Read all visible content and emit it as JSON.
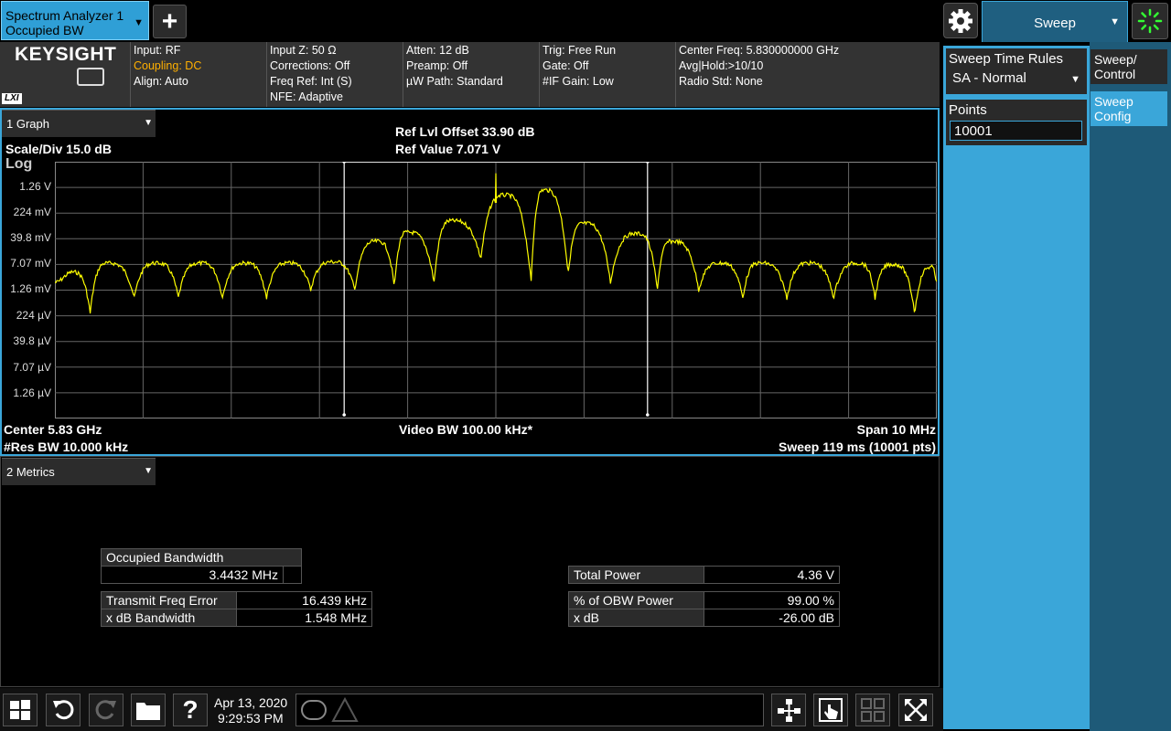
{
  "window": {
    "tab_line1": "Spectrum Analyzer 1",
    "tab_line2": "Occupied BW",
    "mode_tab_label": "Sweep"
  },
  "brand": {
    "name": "KEYSIGHT",
    "lxi": "LXI"
  },
  "info": {
    "col1": [
      "Input: RF",
      "Coupling: DC",
      "Align: Auto"
    ],
    "col2": [
      "Input Z: 50 Ω",
      "Corrections: Off",
      "Freq Ref: Int (S)",
      "NFE: Adaptive"
    ],
    "col3": [
      "Atten: 12 dB",
      "Preamp: Off",
      "µW Path: Standard"
    ],
    "col4": [
      "Trig: Free Run",
      "Gate: Off",
      "#IF Gain: Low"
    ],
    "col5": [
      "Center Freq: 5.830000000 GHz",
      "Avg|Hold:>10/10",
      "Radio Std: None"
    ]
  },
  "graph": {
    "window_label": "1 Graph",
    "scale_div": "Scale/Div 15.0 dB",
    "log_label": "Log",
    "ref_offset": "Ref Lvl Offset 33.90 dB",
    "ref_value": "Ref Value 7.071 V",
    "center": "Center 5.83 GHz",
    "res_bw": "#Res BW 10.000 kHz",
    "video_bw": "Video BW 100.00 kHz*",
    "span": "Span 10 MHz",
    "sweep": "Sweep 119 ms (10001 pts)"
  },
  "chart_data": {
    "type": "line",
    "title": "",
    "xlabel": "",
    "ylabel": "",
    "x_range_mhz": [
      5825,
      5835
    ],
    "y_range_db_div": [
      0,
      10
    ],
    "y_tick_labels": [
      "1.26 V",
      "224 mV",
      "39.8 mV",
      "7.07 mV",
      "1.26 mV",
      "224 µV",
      "39.8 µV",
      "7.07 µV",
      "1.26 µV"
    ],
    "grid": true,
    "obw_markers_mhz": [
      5828.28,
      5831.72
    ],
    "lobe_centers_div": [
      0.2,
      0.6,
      1.15,
      1.65,
      2.15,
      2.65,
      3.15,
      3.65,
      4.0,
      4.5,
      5.1,
      5.55,
      6.0,
      6.6,
      7.0,
      7.55,
      8.0,
      8.55,
      9.1,
      9.5,
      9.95
    ],
    "lobe_peak_div_from_top": [
      4.3,
      3.95,
      3.95,
      3.95,
      3.95,
      3.95,
      3.9,
      3.1,
      2.75,
      2.3,
      1.3,
      1.1,
      2.4,
      2.8,
      3.1,
      3.95,
      3.95,
      3.95,
      3.95,
      4.0,
      4.1
    ],
    "null_positions_div": [
      0.4,
      0.9,
      1.4,
      1.9,
      2.4,
      2.9,
      3.4,
      3.85,
      4.3,
      4.83,
      5.4,
      5.82,
      6.3,
      6.83,
      7.3,
      7.8,
      8.3,
      8.83,
      9.3,
      9.75
    ],
    "null_depth_div_from_top": [
      5.9,
      5.3,
      5.3,
      5.3,
      5.3,
      5.0,
      5.0,
      4.9,
      4.7,
      3.8,
      4.7,
      4.4,
      4.7,
      5.0,
      5.0,
      5.3,
      5.3,
      5.3,
      5.3,
      5.9
    ],
    "carrier_spike_div": 5.0,
    "carrier_spike_top_div": 0.45
  },
  "metrics": {
    "window_label": "2 Metrics",
    "occupied_bw_label": "Occupied Bandwidth",
    "occupied_bw_value": "3.4432 MHz",
    "tx_freq_err_label": "Transmit Freq Error",
    "tx_freq_err_value": "16.439 kHz",
    "xdb_bw_label": "x dB Bandwidth",
    "xdb_bw_value": "1.548 MHz",
    "total_power_label": "Total Power",
    "total_power_value": "4.36 V",
    "pct_obw_label": "% of OBW Power",
    "pct_obw_value": "99.00 %",
    "xdb_label": "x dB",
    "xdb_value": "-26.00 dB"
  },
  "panel": {
    "sweep_time_rules_label": "Sweep Time Rules",
    "sweep_time_rules_value": "SA - Normal",
    "points_label": "Points",
    "points_value": "10001",
    "side_tab1": "Sweep/ Control",
    "side_tab2": "Sweep Config"
  },
  "taskbar": {
    "date": "Apr 13, 2020",
    "time": "9:29:53 PM"
  },
  "colors": {
    "trace": "#ffff00",
    "accent": "#2f9fd6",
    "coupling": "#ffb000",
    "panel": "#3aa6d9"
  }
}
